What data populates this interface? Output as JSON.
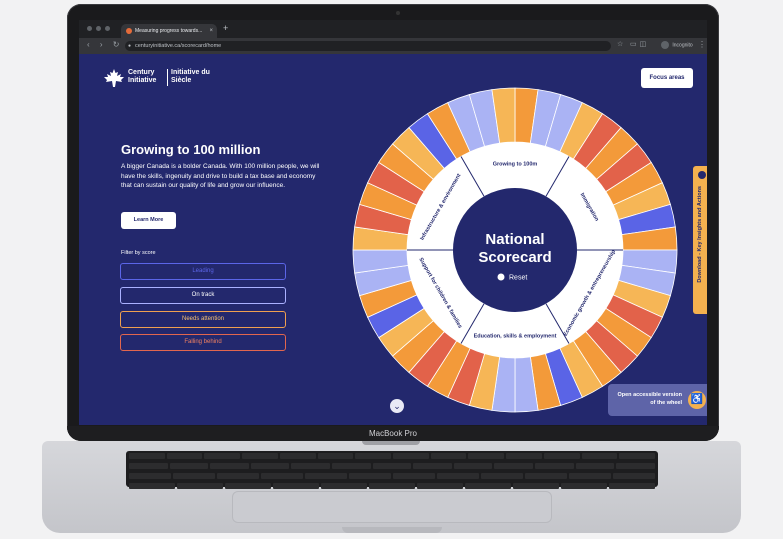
{
  "browser": {
    "tab_title": "Measuring progress towards...",
    "tab_close": "×",
    "new_tab": "+",
    "nav": "‹ › ↻",
    "url": "centuryinitiative.ca/scorecard/home",
    "profile": "Incognito",
    "menu": "⋮"
  },
  "header": {
    "logo_en": "Century Initiative",
    "logo_fr": "Initiative du Siècle",
    "focus_areas": "Focus areas"
  },
  "hero": {
    "title": "Growing to 100 million",
    "body": "A bigger Canada is a bolder Canada. With 100 million people, we will have the skills, ingenuity and drive to build a tax base and economy that can sustain our quality of life and grow our influence.",
    "learn_more": "Learn More"
  },
  "filter": {
    "label": "Filter by score",
    "leading": "Leading",
    "on_track": "On track",
    "needs_attention": "Needs attention",
    "failing_behind": "Falling behind"
  },
  "wheel": {
    "center_title_1": "National",
    "center_title_2": "Scorecard",
    "reset": "Reset",
    "categories": [
      "Growing to 100m",
      "Immigration",
      "Economic growth & entrepreneurship",
      "Education, skills & employment",
      "Support for children & families",
      "Infrastructure & environment"
    ],
    "colors": {
      "orange": "#f39a3a",
      "light_orange": "#f6b656",
      "red": "#e2624a",
      "blue": "#5a64e6",
      "lavender": "#aab3f4",
      "navy": "#23286d"
    }
  },
  "sidebar": {
    "download": "Download - Key Insights and Actions"
  },
  "accessibility": {
    "text": "Open accessible version of the wheel",
    "icon": "accessibility-icon"
  },
  "laptop": {
    "model": "MacBook Pro"
  },
  "scroll": {
    "icon": "⌄"
  }
}
